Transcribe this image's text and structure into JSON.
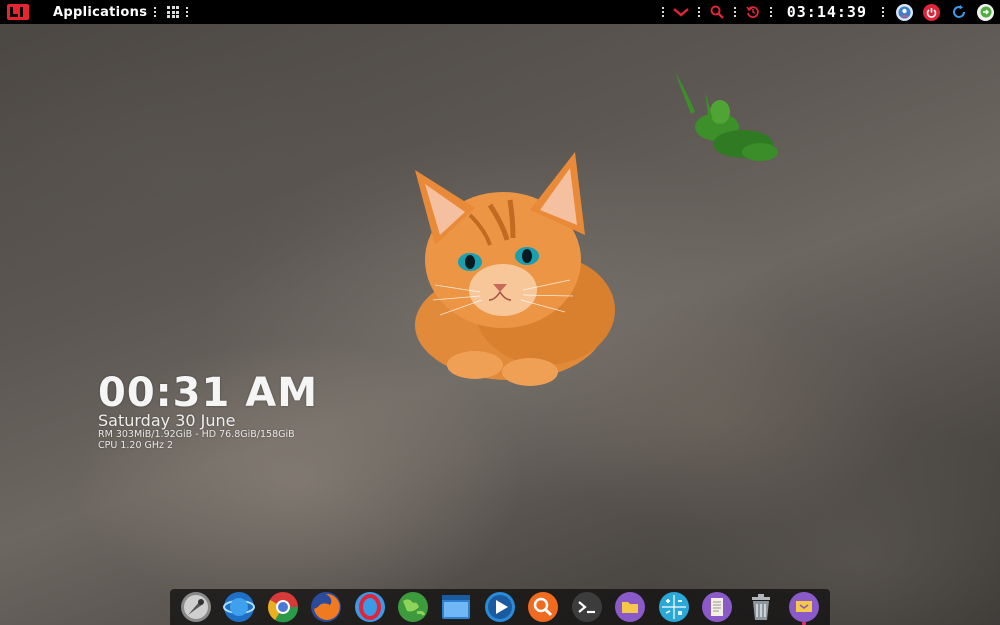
{
  "panel": {
    "menu_label": "Applications",
    "clock": "03:14:39"
  },
  "widget": {
    "time": "00:31 AM",
    "date": "Saturday 30 June",
    "memory": "RM 303MiB/1.92GiB - HD 76.8GiB/158GiB",
    "cpu": "CPU 1.20 GHz 2"
  },
  "dock": {
    "items": [
      {
        "name": "rocket-icon"
      },
      {
        "name": "globe-browser-icon"
      },
      {
        "name": "chrome-icon"
      },
      {
        "name": "firefox-icon"
      },
      {
        "name": "opera-icon"
      },
      {
        "name": "earth-icon"
      },
      {
        "name": "window-icon"
      },
      {
        "name": "media-player-icon"
      },
      {
        "name": "search-icon"
      },
      {
        "name": "terminal-icon"
      },
      {
        "name": "folder-icon"
      },
      {
        "name": "calculator-icon"
      },
      {
        "name": "text-editor-icon"
      },
      {
        "name": "trash-icon"
      },
      {
        "name": "monitor-icon"
      }
    ]
  },
  "colors": {
    "accent_red": "#e0243a",
    "panel_bg": "#000000"
  }
}
